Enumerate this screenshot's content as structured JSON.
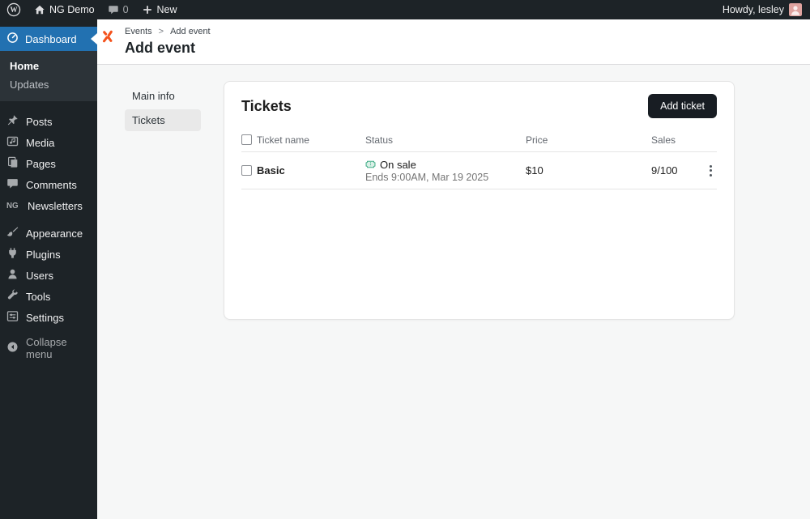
{
  "admin_bar": {
    "site_name": "NG Demo",
    "comment_count": "0",
    "new_label": "New",
    "howdy": "Howdy, lesley"
  },
  "sidebar": {
    "dashboard_label": "Dashboard",
    "submenu": [
      {
        "label": "Home"
      },
      {
        "label": "Updates"
      }
    ],
    "items": [
      {
        "label": "Posts",
        "icon": "pushpin-icon"
      },
      {
        "label": "Media",
        "icon": "media-icon"
      },
      {
        "label": "Pages",
        "icon": "pages-icon"
      },
      {
        "label": "Comments",
        "icon": "comment-bubble-icon"
      },
      {
        "label": "Newsletters",
        "icon": "ng-monogram-icon"
      },
      {
        "label": "Appearance",
        "icon": "paintbrush-icon"
      },
      {
        "label": "Plugins",
        "icon": "plug-icon"
      },
      {
        "label": "Users",
        "icon": "person-icon"
      },
      {
        "label": "Tools",
        "icon": "wrench-icon"
      },
      {
        "label": "Settings",
        "icon": "control-panel-icon"
      }
    ],
    "collapse_label": "Collapse menu"
  },
  "page_header": {
    "breadcrumb": {
      "parent": "Events",
      "separator": ">",
      "current": "Add event"
    },
    "title": "Add event"
  },
  "content_nav": {
    "items": [
      {
        "label": "Main info",
        "active": false
      },
      {
        "label": "Tickets",
        "active": true
      }
    ]
  },
  "tickets_panel": {
    "title": "Tickets",
    "add_ticket_label": "Add ticket",
    "table": {
      "headers": {
        "name": "Ticket name",
        "status": "Status",
        "price": "Price",
        "sales": "Sales"
      },
      "rows": [
        {
          "name": "Basic",
          "status": "On sale",
          "status_detail": "Ends 9:00AM, Mar 19 2025",
          "price": "$10",
          "sales": "9/100"
        }
      ]
    }
  },
  "icons": {
    "wordpress-logo": "W in circle",
    "home-icon": "house",
    "comments-icon": "speech bubble",
    "plus-icon": "+",
    "avatar": "pink user photo",
    "dashboard-icon": "gauge",
    "events-logo-icon": "orange spark",
    "ticket-icon": "green ticket stub",
    "kebab-menu-icon": "vertical three dots",
    "collapse-icon": "circled left arrow"
  },
  "colors": {
    "accent_blue": "#2271b1",
    "admin_dark": "#1d2327",
    "submenu_dark": "#2c3338",
    "logo_orange": "#f4521c",
    "status_green": "#2aa37a",
    "button_dark": "#181d23",
    "content_bg": "#f6f7f7"
  }
}
